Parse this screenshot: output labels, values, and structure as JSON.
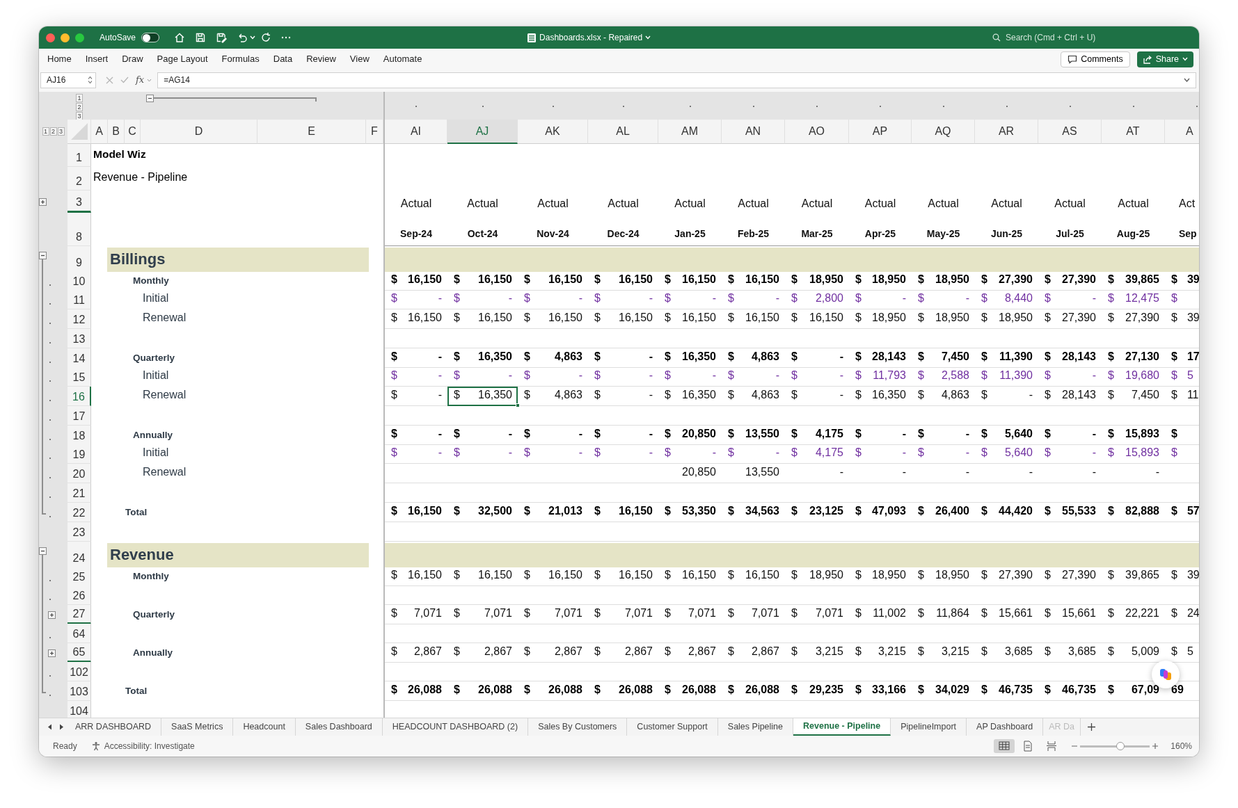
{
  "title_bar": {
    "autosave_label": "AutoSave",
    "autosave_on": false,
    "document_title": "Dashboards.xlsx - Repaired",
    "search": {
      "placeholder": "Search (Cmd + Ctrl + U)"
    }
  },
  "menu_tabs": [
    "Home",
    "Insert",
    "Draw",
    "Page Layout",
    "Formulas",
    "Data",
    "Review",
    "View",
    "Automate"
  ],
  "comments_button": "Comments",
  "share_button": "Share",
  "formula_bar": {
    "name_box": "AJ16",
    "function_label": "fx",
    "formula": "=AG14"
  },
  "column_outline_levels": [
    "1",
    "2",
    "3"
  ],
  "row_outline_levels": [
    "1",
    "2",
    "3"
  ],
  "frozen_columns": [
    {
      "letter": "A",
      "selected": false
    },
    {
      "letter": "B",
      "selected": false
    },
    {
      "letter": "C",
      "selected": false
    },
    {
      "letter": "D",
      "selected": false
    },
    {
      "letter": "E",
      "selected": false
    },
    {
      "letter": "F",
      "selected": false
    }
  ],
  "columns": [
    {
      "letter": "AI",
      "selected": false
    },
    {
      "letter": "AJ",
      "selected": true
    },
    {
      "letter": "AK",
      "selected": false
    },
    {
      "letter": "AL",
      "selected": false
    },
    {
      "letter": "AM",
      "selected": false
    },
    {
      "letter": "AN",
      "selected": false
    },
    {
      "letter": "AO",
      "selected": false
    },
    {
      "letter": "AP",
      "selected": false
    },
    {
      "letter": "AQ",
      "selected": false
    },
    {
      "letter": "AR",
      "selected": false
    },
    {
      "letter": "AS",
      "selected": false
    },
    {
      "letter": "AT",
      "selected": false
    },
    {
      "letter": "A",
      "selected": false
    }
  ],
  "rows": [
    {
      "number": "1",
      "selected": false,
      "hidden_after": false,
      "grouped": false,
      "kind": "title",
      "label": "Model Wiz"
    },
    {
      "number": "2",
      "selected": false,
      "hidden_after": false,
      "grouped": false,
      "kind": "subtitle",
      "label": "Revenue - Pipeline"
    },
    {
      "number": "3",
      "selected": false,
      "hidden_after": true,
      "grouped": false,
      "expanded": false,
      "kind": "header",
      "cells": [
        "Actual",
        "Actual",
        "Actual",
        "Actual",
        "Actual",
        "Actual",
        "Actual",
        "Actual",
        "Actual",
        "Actual",
        "Actual",
        "Actual",
        "Act"
      ]
    },
    {
      "number": "8",
      "selected": false,
      "hidden_after": false,
      "grouped": false,
      "kind": "months",
      "cells": [
        "Sep-24",
        "Oct-24",
        "Nov-24",
        "Dec-24",
        "Jan-25",
        "Feb-25",
        "Mar-25",
        "Apr-25",
        "May-25",
        "Jun-25",
        "Jul-25",
        "Aug-25",
        "Sep"
      ]
    },
    {
      "number": "9",
      "selected": false,
      "hidden_after": false,
      "grouped": false,
      "expanded": true,
      "kind": "section",
      "label": "Billings"
    },
    {
      "number": "10",
      "selected": false,
      "hidden_after": false,
      "grouped": true,
      "kind": "group",
      "label": "Monthly",
      "bold": true,
      "color": "#000000",
      "cells": [
        [
          "$",
          "16,150"
        ],
        [
          "$",
          "16,150"
        ],
        [
          "$",
          "16,150"
        ],
        [
          "$",
          "16,150"
        ],
        [
          "$",
          "16,150"
        ],
        [
          "$",
          "16,150"
        ],
        [
          "$",
          "18,950"
        ],
        [
          "$",
          "18,950"
        ],
        [
          "$",
          "18,950"
        ],
        [
          "$",
          "27,390"
        ],
        [
          "$",
          "27,390"
        ],
        [
          "$",
          "39,865"
        ],
        [
          "$",
          "39"
        ]
      ]
    },
    {
      "number": "11",
      "selected": false,
      "hidden_after": false,
      "grouped": true,
      "kind": "item",
      "label": "Initial",
      "bold": false,
      "color": "#7030a0",
      "cells": [
        [
          "$",
          "-"
        ],
        [
          "$",
          "-"
        ],
        [
          "$",
          "-"
        ],
        [
          "$",
          "-"
        ],
        [
          "$",
          "-"
        ],
        [
          "$",
          "-"
        ],
        [
          "$",
          "2,800"
        ],
        [
          "$",
          "-"
        ],
        [
          "$",
          "-"
        ],
        [
          "$",
          "8,440"
        ],
        [
          "$",
          "-"
        ],
        [
          "$",
          "12,475"
        ],
        [
          "$"
        ]
      ]
    },
    {
      "number": "12",
      "selected": false,
      "hidden_after": false,
      "grouped": true,
      "kind": "item",
      "label": "Renewal",
      "bold": false,
      "color": "#111111",
      "cells": [
        [
          "$",
          "16,150"
        ],
        [
          "$",
          "16,150"
        ],
        [
          "$",
          "16,150"
        ],
        [
          "$",
          "16,150"
        ],
        [
          "$",
          "16,150"
        ],
        [
          "$",
          "16,150"
        ],
        [
          "$",
          "16,150"
        ],
        [
          "$",
          "18,950"
        ],
        [
          "$",
          "18,950"
        ],
        [
          "$",
          "18,950"
        ],
        [
          "$",
          "27,390"
        ],
        [
          "$",
          "27,390"
        ],
        [
          "$",
          "39"
        ]
      ]
    },
    {
      "number": "13",
      "selected": false,
      "hidden_after": false,
      "grouped": true,
      "kind": "blank"
    },
    {
      "number": "14",
      "selected": false,
      "hidden_after": false,
      "grouped": true,
      "kind": "group",
      "label": "Quarterly",
      "bold": true,
      "color": "#000000",
      "cells": [
        [
          "$",
          "-"
        ],
        [
          "$",
          "16,350"
        ],
        [
          "$",
          "4,863"
        ],
        [
          "$",
          "-"
        ],
        [
          "$",
          "16,350"
        ],
        [
          "$",
          "4,863"
        ],
        [
          "$",
          "-"
        ],
        [
          "$",
          "28,143"
        ],
        [
          "$",
          "7,450"
        ],
        [
          "$",
          "11,390"
        ],
        [
          "$",
          "28,143"
        ],
        [
          "$",
          "27,130"
        ],
        [
          "$",
          "17"
        ]
      ]
    },
    {
      "number": "15",
      "selected": false,
      "hidden_after": false,
      "grouped": true,
      "kind": "item",
      "label": "Initial",
      "bold": false,
      "color": "#7030a0",
      "cells": [
        [
          "$",
          "-"
        ],
        [
          "$",
          "-"
        ],
        [
          "$",
          "-"
        ],
        [
          "$",
          "-"
        ],
        [
          "$",
          "-"
        ],
        [
          "$",
          "-"
        ],
        [
          "$",
          "-"
        ],
        [
          "$",
          "11,793"
        ],
        [
          "$",
          "2,588"
        ],
        [
          "$",
          "11,390"
        ],
        [
          "$",
          "-"
        ],
        [
          "$",
          "19,680"
        ],
        [
          "$",
          "5"
        ]
      ]
    },
    {
      "number": "16",
      "selected": true,
      "hidden_after": false,
      "grouped": true,
      "kind": "item",
      "label": "Renewal",
      "bold": false,
      "color": "#111111",
      "cells": [
        [
          "$",
          "-"
        ],
        [
          "$",
          "16,350"
        ],
        [
          "$",
          "4,863"
        ],
        [
          "$",
          "-"
        ],
        [
          "$",
          "16,350"
        ],
        [
          "$",
          "4,863"
        ],
        [
          "$",
          "-"
        ],
        [
          "$",
          "16,350"
        ],
        [
          "$",
          "4,863"
        ],
        [
          "$",
          "-"
        ],
        [
          "$",
          "28,143"
        ],
        [
          "$",
          "7,450"
        ],
        [
          "$",
          "11"
        ]
      ]
    },
    {
      "number": "17",
      "selected": false,
      "hidden_after": false,
      "grouped": true,
      "kind": "blank"
    },
    {
      "number": "18",
      "selected": false,
      "hidden_after": false,
      "grouped": true,
      "kind": "group",
      "label": "Annually",
      "bold": true,
      "color": "#000000",
      "cells": [
        [
          "$",
          "-"
        ],
        [
          "$",
          "-"
        ],
        [
          "$",
          "-"
        ],
        [
          "$",
          "-"
        ],
        [
          "$",
          "20,850"
        ],
        [
          "$",
          "13,550"
        ],
        [
          "$",
          "4,175"
        ],
        [
          "$",
          "-"
        ],
        [
          "$",
          "-"
        ],
        [
          "$",
          "5,640"
        ],
        [
          "$",
          "-"
        ],
        [
          "$",
          "15,893"
        ],
        [
          "$"
        ]
      ]
    },
    {
      "number": "19",
      "selected": false,
      "hidden_after": false,
      "grouped": true,
      "kind": "item",
      "label": "Initial",
      "bold": false,
      "color": "#7030a0",
      "cells": [
        [
          "$",
          "-"
        ],
        [
          "$",
          "-"
        ],
        [
          "$",
          "-"
        ],
        [
          "$",
          "-"
        ],
        [
          "$",
          "-"
        ],
        [
          "$",
          "-"
        ],
        [
          "$",
          "4,175"
        ],
        [
          "$",
          "-"
        ],
        [
          "$",
          "-"
        ],
        [
          "$",
          "5,640"
        ],
        [
          "$",
          "-"
        ],
        [
          "$",
          "15,893"
        ],
        [
          "$"
        ]
      ]
    },
    {
      "number": "20",
      "selected": false,
      "hidden_after": false,
      "grouped": true,
      "kind": "item",
      "label": "Renewal",
      "bold": false,
      "color": "#111111",
      "cells": [
        null,
        null,
        null,
        null,
        "20,850",
        "13,550",
        "-",
        "-",
        "-",
        "-",
        "-",
        "-",
        null
      ]
    },
    {
      "number": "21",
      "selected": false,
      "hidden_after": false,
      "grouped": true,
      "kind": "blank"
    },
    {
      "number": "22",
      "selected": false,
      "hidden_after": false,
      "grouped": true,
      "kind": "total",
      "label": "Total",
      "bold": true,
      "color": "#000000",
      "cells": [
        [
          "$",
          "16,150"
        ],
        [
          "$",
          "32,500"
        ],
        [
          "$",
          "21,013"
        ],
        [
          "$",
          "16,150"
        ],
        [
          "$",
          "53,350"
        ],
        [
          "$",
          "34,563"
        ],
        [
          "$",
          "23,125"
        ],
        [
          "$",
          "47,093"
        ],
        [
          "$",
          "26,400"
        ],
        [
          "$",
          "44,420"
        ],
        [
          "$",
          "55,533"
        ],
        [
          "$",
          "82,888"
        ],
        [
          "$",
          "57"
        ]
      ]
    },
    {
      "number": "23",
      "selected": false,
      "hidden_after": false,
      "grouped": false,
      "kind": "blank"
    },
    {
      "number": "24",
      "selected": false,
      "hidden_after": false,
      "grouped": false,
      "expanded": true,
      "kind": "section",
      "label": "Revenue"
    },
    {
      "number": "25",
      "selected": false,
      "hidden_after": false,
      "grouped": true,
      "kind": "group",
      "label": "Monthly",
      "bold": false,
      "color": "#111111",
      "cells": [
        [
          "$",
          "16,150"
        ],
        [
          "$",
          "16,150"
        ],
        [
          "$",
          "16,150"
        ],
        [
          "$",
          "16,150"
        ],
        [
          "$",
          "16,150"
        ],
        [
          "$",
          "16,150"
        ],
        [
          "$",
          "18,950"
        ],
        [
          "$",
          "18,950"
        ],
        [
          "$",
          "18,950"
        ],
        [
          "$",
          "27,390"
        ],
        [
          "$",
          "27,390"
        ],
        [
          "$",
          "39,865"
        ],
        [
          "$",
          "39"
        ]
      ]
    },
    {
      "number": "26",
      "selected": false,
      "hidden_after": false,
      "grouped": true,
      "kind": "blank"
    },
    {
      "number": "27",
      "selected": false,
      "hidden_after": true,
      "grouped": true,
      "expanded": false,
      "kind": "group",
      "label": "Quarterly",
      "bold": false,
      "color": "#111111",
      "cells": [
        [
          "$",
          "7,071"
        ],
        [
          "$",
          "7,071"
        ],
        [
          "$",
          "7,071"
        ],
        [
          "$",
          "7,071"
        ],
        [
          "$",
          "7,071"
        ],
        [
          "$",
          "7,071"
        ],
        [
          "$",
          "7,071"
        ],
        [
          "$",
          "11,002"
        ],
        [
          "$",
          "11,864"
        ],
        [
          "$",
          "15,661"
        ],
        [
          "$",
          "15,661"
        ],
        [
          "$",
          "22,221"
        ],
        [
          "$",
          "24"
        ]
      ]
    },
    {
      "number": "64",
      "selected": false,
      "hidden_after": false,
      "grouped": true,
      "kind": "blank"
    },
    {
      "number": "65",
      "selected": false,
      "hidden_after": true,
      "grouped": true,
      "expanded": false,
      "kind": "group",
      "label": "Annually",
      "bold": false,
      "color": "#111111",
      "cells": [
        [
          "$",
          "2,867"
        ],
        [
          "$",
          "2,867"
        ],
        [
          "$",
          "2,867"
        ],
        [
          "$",
          "2,867"
        ],
        [
          "$",
          "2,867"
        ],
        [
          "$",
          "2,867"
        ],
        [
          "$",
          "3,215"
        ],
        [
          "$",
          "3,215"
        ],
        [
          "$",
          "3,215"
        ],
        [
          "$",
          "3,685"
        ],
        [
          "$",
          "3,685"
        ],
        [
          "$",
          "5,009"
        ],
        [
          "$",
          "5"
        ]
      ]
    },
    {
      "number": "102",
      "selected": false,
      "hidden_after": false,
      "grouped": true,
      "kind": "blank"
    },
    {
      "number": "103",
      "selected": false,
      "hidden_after": false,
      "grouped": true,
      "kind": "total",
      "label": "Total",
      "bold": true,
      "color": "#000000",
      "cells": [
        [
          "$",
          "26,088"
        ],
        [
          "$",
          "26,088"
        ],
        [
          "$",
          "26,088"
        ],
        [
          "$",
          "26,088"
        ],
        [
          "$",
          "26,088"
        ],
        [
          "$",
          "26,088"
        ],
        [
          "$",
          "29,235"
        ],
        [
          "$",
          "33,166"
        ],
        [
          "$",
          "34,029"
        ],
        [
          "$",
          "46,735"
        ],
        [
          "$",
          "46,735"
        ],
        [
          "$",
          "67,09"
        ],
        [
          "69"
        ]
      ]
    },
    {
      "number": "104",
      "selected": false,
      "hidden_after": false,
      "grouped": false,
      "kind": "blank"
    }
  ],
  "sheet_tabs": [
    {
      "label": "ARR DASHBOARD",
      "selected": false
    },
    {
      "label": "SaaS Metrics",
      "selected": false
    },
    {
      "label": "Headcount",
      "selected": false
    },
    {
      "label": "Sales Dashboard",
      "selected": false
    },
    {
      "label": "HEADCOUNT DASHBOARD (2)",
      "selected": false
    },
    {
      "label": "Sales By Customers",
      "selected": false
    },
    {
      "label": "Customer Support",
      "selected": false
    },
    {
      "label": "Sales Pipeline",
      "selected": false
    },
    {
      "label": "Revenue - Pipeline",
      "selected": true
    },
    {
      "label": "PipelineImport",
      "selected": false
    },
    {
      "label": "AP Dashboard",
      "selected": false
    },
    {
      "label": "AR Da",
      "selected": false
    }
  ],
  "status_bar": {
    "mode": "Ready",
    "accessibility": "Accessibility: Investigate",
    "views": [
      {
        "kind": "normal",
        "selected": true
      },
      {
        "kind": "page-layout",
        "selected": false
      },
      {
        "kind": "page-break",
        "selected": false
      }
    ],
    "zoom_slider": {
      "level": 0.58
    },
    "zoom": "160%"
  }
}
